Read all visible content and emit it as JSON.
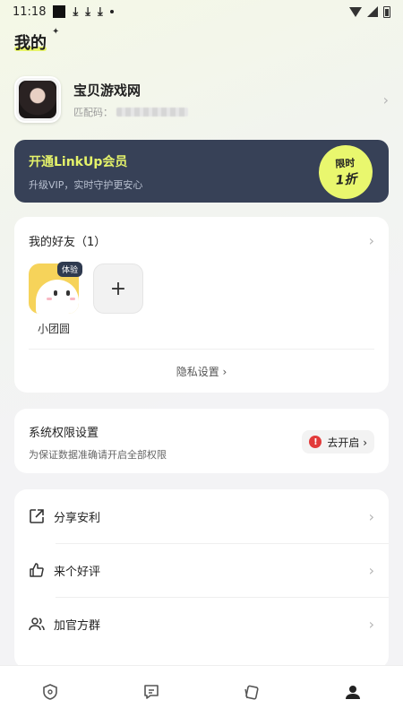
{
  "status_bar": {
    "time": "11:18",
    "download_glyph": "⤓"
  },
  "page_title": "我的",
  "profile": {
    "name": "宝贝游戏网",
    "pair_code_label": "匹配码："
  },
  "vip": {
    "title": "开通LinkUp会员",
    "subtitle": "升级VIP，实时守护更安心",
    "badge_line1": "限时",
    "badge_line2": "1折"
  },
  "friends": {
    "title": "我的好友（1）",
    "items": [
      {
        "name": "小团圆",
        "tag": "体验"
      }
    ],
    "add_symbol": "+",
    "privacy_label": "隐私设置 ›"
  },
  "permissions": {
    "title": "系统权限设置",
    "subtitle": "为保证数据准确请开启全部权限",
    "button_label": "去开启 ›",
    "warning_symbol": "!"
  },
  "menu": [
    {
      "label": "分享安利",
      "icon": "share-icon"
    },
    {
      "label": "来个好评",
      "icon": "thumbs-up-icon"
    },
    {
      "label": "加官方群",
      "icon": "group-icon"
    }
  ],
  "bottom_nav": [
    {
      "icon": "shield-icon",
      "active": false
    },
    {
      "icon": "message-icon",
      "active": false
    },
    {
      "icon": "cards-icon",
      "active": false
    },
    {
      "icon": "profile-icon",
      "active": true
    }
  ],
  "colors": {
    "vip_bg": "#374157",
    "accent_lime": "#e4f26a",
    "warning": "#e23b3b"
  }
}
